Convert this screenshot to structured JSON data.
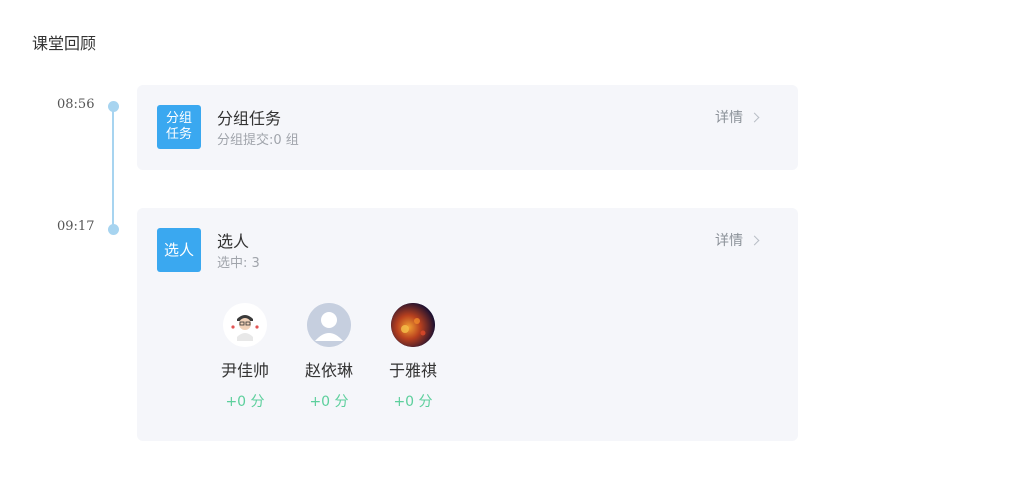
{
  "page": {
    "title": "课堂回顾"
  },
  "timeline": [
    {
      "time": "08:56",
      "badge_lines": [
        "分组",
        "任务"
      ],
      "title": "分组任务",
      "subtitle": "分组提交:0 组",
      "detail_label": "详情"
    },
    {
      "time": "09:17",
      "badge_lines": [
        "选人"
      ],
      "title": "选人",
      "subtitle": "选中: 3",
      "detail_label": "详情",
      "students": [
        {
          "name": "尹佳帅",
          "score": "+0 分",
          "avatar": "cartoon-avatar-icon"
        },
        {
          "name": "赵依琳",
          "score": "+0 分",
          "avatar": "default-avatar-icon"
        },
        {
          "name": "于雅祺",
          "score": "+0 分",
          "avatar": "photo-avatar-icon"
        }
      ]
    }
  ],
  "colors": {
    "accent": "#3aa8f0",
    "timeline": "#a7d4f0",
    "score": "#5ccf9c",
    "card_bg": "#f5f6fa"
  }
}
